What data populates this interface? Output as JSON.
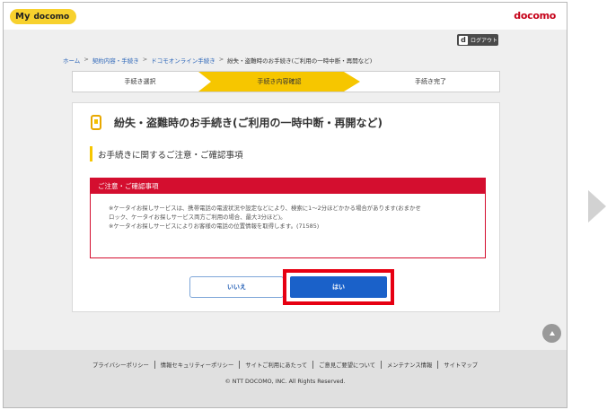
{
  "header": {
    "logo_my": "My",
    "logo_docomo": "docomo",
    "brand": "docomo"
  },
  "logout": {
    "icon_letter": "d",
    "label": "ログアウト"
  },
  "breadcrumb": {
    "items": [
      {
        "label": "ホーム"
      },
      {
        "label": "契約内容・手続き"
      },
      {
        "label": "ドコモオンライン手続き"
      },
      {
        "label": "紛失・盗難時のお手続き(ご利用の一時中断・再開など)"
      }
    ]
  },
  "steps": {
    "items": [
      {
        "label": "手続き選択"
      },
      {
        "label": "手続き内容確認"
      },
      {
        "label": "手続き完了"
      }
    ],
    "active_index": 1
  },
  "main": {
    "title": "紛失・盗難時のお手続き(ご利用の一時中断・再開など)",
    "section_heading": "お手続きに関するご注意・ご確認事項",
    "notice": {
      "heading": "ご注意・ご確認事項",
      "lines": [
        "※ケータイお探しサービスは、携帯電話の電波状況や設定などにより、検索に1〜2分ほどかかる場合があります(おまかせ",
        "ロック、ケータイお探しサービス両方ご利用の場合、最大3分ほど)。",
        "※ケータイお探しサービスによりお客様の電話の位置情報を取得します。(71585)"
      ]
    },
    "buttons": {
      "no_label": "いいえ",
      "yes_label": "はい"
    }
  },
  "footer": {
    "links": [
      {
        "label": "プライバシーポリシー"
      },
      {
        "label": "情報セキュリティーポリシー"
      },
      {
        "label": "サイトご利用にあたって"
      },
      {
        "label": "ご意見ご要望について"
      },
      {
        "label": "メンテナンス情報"
      },
      {
        "label": "サイトマップ"
      }
    ],
    "copyright": "© NTT DOCOMO, INC. All Rights Reserved."
  },
  "colors": {
    "brand_red": "#c50018",
    "accent_yellow": "#f6c600",
    "primary_blue": "#1a61c9",
    "highlight_red": "#e60012"
  }
}
